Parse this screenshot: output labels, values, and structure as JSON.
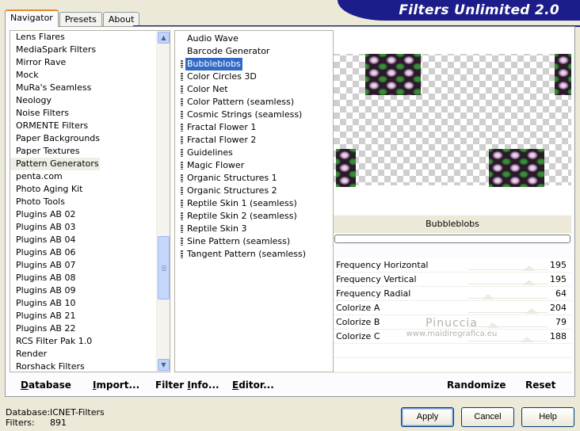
{
  "app": {
    "title": "Filters Unlimited 2.0",
    "brand_color": "#1c1d8a",
    "selection_color": "#316ac5"
  },
  "tabs": [
    {
      "label": "Navigator",
      "active": true
    },
    {
      "label": "Presets",
      "active": false
    },
    {
      "label": "About",
      "active": false
    }
  ],
  "categories": {
    "selected": "Pattern Generators",
    "items": [
      "Lens Flares",
      "MediaSpark Filters",
      "Mirror Rave",
      "Mock",
      "MuRa's Seamless",
      "Neology",
      "Noise Filters",
      "ORMENTE Filters",
      "Paper Backgrounds",
      "Paper Textures",
      "Pattern Generators",
      "penta.com",
      "Photo Aging Kit",
      "Photo Tools",
      "Plugins AB 02",
      "Plugins AB 03",
      "Plugins AB 04",
      "Plugins AB 06",
      "Plugins AB 07",
      "Plugins AB 08",
      "Plugins AB 09",
      "Plugins AB 10",
      "Plugins AB 21",
      "Plugins AB 22",
      "RCS Filter Pak 1.0",
      "Render",
      "Rorshack Filters"
    ]
  },
  "filters": {
    "selected": "Bubbleblobs",
    "items": [
      {
        "label": "Audio Wave",
        "grip": false
      },
      {
        "label": "Barcode Generator",
        "grip": false
      },
      {
        "label": "Bubbleblobs",
        "grip": true
      },
      {
        "label": "Color Circles 3D",
        "grip": true
      },
      {
        "label": "Color Net",
        "grip": true
      },
      {
        "label": "Color Pattern (seamless)",
        "grip": true
      },
      {
        "label": "Cosmic Strings (seamless)",
        "grip": true
      },
      {
        "label": "Fractal Flower 1",
        "grip": true
      },
      {
        "label": "Fractal Flower 2",
        "grip": true
      },
      {
        "label": "Guidelines",
        "grip": true
      },
      {
        "label": "Magic Flower",
        "grip": true
      },
      {
        "label": "Organic Structures 1",
        "grip": true
      },
      {
        "label": "Organic Structures 2",
        "grip": true
      },
      {
        "label": "Reptile Skin 1 (seamless)",
        "grip": true
      },
      {
        "label": "Reptile Skin 2 (seamless)",
        "grip": true
      },
      {
        "label": "Reptile Skin 3",
        "grip": true
      },
      {
        "label": "Sine Pattern (seamless)",
        "grip": true
      },
      {
        "label": "Tangent Pattern (seamless)",
        "grip": true
      }
    ]
  },
  "preview": {
    "filter_name": "Bubbleblobs"
  },
  "params": [
    {
      "name": "Frequency Horizontal",
      "value": "195",
      "level": 0.765
    },
    {
      "name": "Frequency Vertical",
      "value": "195",
      "level": 0.765
    },
    {
      "name": "Frequency Radial",
      "value": "64",
      "level": 0.25
    },
    {
      "name": "Colorize A",
      "value": "204",
      "level": 0.8
    },
    {
      "name": "Colorize B",
      "value": "79",
      "level": 0.31
    },
    {
      "name": "Colorize C",
      "value": "188",
      "level": 0.737
    }
  ],
  "watermark": {
    "line1": "Pinuccia",
    "line2": "www.maidiregrafica.eu"
  },
  "toolbar": {
    "database": {
      "u": "D",
      "rest": "atabase"
    },
    "import": {
      "u": "I",
      "rest": "mport..."
    },
    "filter_info": {
      "pre": "Filter ",
      "u": "I",
      "rest": "nfo..."
    },
    "editor": {
      "u": "E",
      "rest": "ditor..."
    },
    "randomize": "Randomize",
    "reset": "Reset"
  },
  "status": {
    "database_label": "Database:",
    "database_value": "ICNET-Filters",
    "filters_label": "Filters:",
    "filters_value": "891"
  },
  "buttons": {
    "apply": "Apply",
    "cancel": "Cancel",
    "help": "Help"
  }
}
